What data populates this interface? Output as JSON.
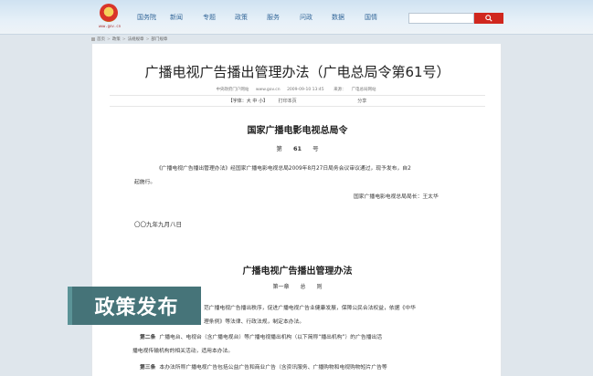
{
  "header": {
    "site_tag": "www.gov.cn",
    "nav": [
      "国务院",
      "新闻",
      "专题",
      "政策",
      "服务",
      "问政",
      "数据",
      "国情"
    ],
    "search_placeholder": ""
  },
  "breadcrumb": [
    "首页",
    "政策",
    "法规规章",
    "部门规章"
  ],
  "article": {
    "title": "广播电视广告播出管理办法（广电总局令第61号）",
    "source_site": "中央政府门户网站",
    "source_url": "www.gov.cn",
    "datetime": "2009-09-10 13:45",
    "origin_label": "来源：",
    "origin": "广电总局网站",
    "font_size_label": "【字体：大 中 小】",
    "print_label": "打印本页",
    "share_label": "分享",
    "decree_heading": "国家广播电影电视总局令",
    "decree_prefix": "第",
    "decree_num": "61",
    "decree_suffix": "号",
    "para1_a": "《广播电视广告播出管理办法》经国家广播电影电视总局2009年8月27日局务会议审议通过，现予发布，自2",
    "para1_b": "起施行。",
    "signature": "国家广播电影电视总局局长：王太华",
    "date_line": "〇〇九年九月八日",
    "law_heading": "广播电视广告播出管理办法",
    "chapter": "第一章　　总　　则",
    "art1_a": "范广播电视广告播出秩序，促进广播电视广告业健康发展，保障公民合法权益，依据《中华",
    "art1_b": "理条例》等法律、行政法规，制定本办法。",
    "art2_label": "第二条",
    "art2_a": "广播电台、电视台（含广播电视台）等广播电视播出机构（以下简称“播出机构”）的广告播出活",
    "art2_b": "播电视传输机构的相关活动，适用本办法。",
    "art3_label": "第三条",
    "art3_a": "本办法所称广播电视广告包括公益广告和商业广告（含资讯服务、广播购物和电视购物短片广告等"
  },
  "banner": {
    "label": "政策发布"
  },
  "colors": {
    "search_button": "#d0271e",
    "nav_link": "#35689a",
    "banner": "#3d6d72"
  }
}
